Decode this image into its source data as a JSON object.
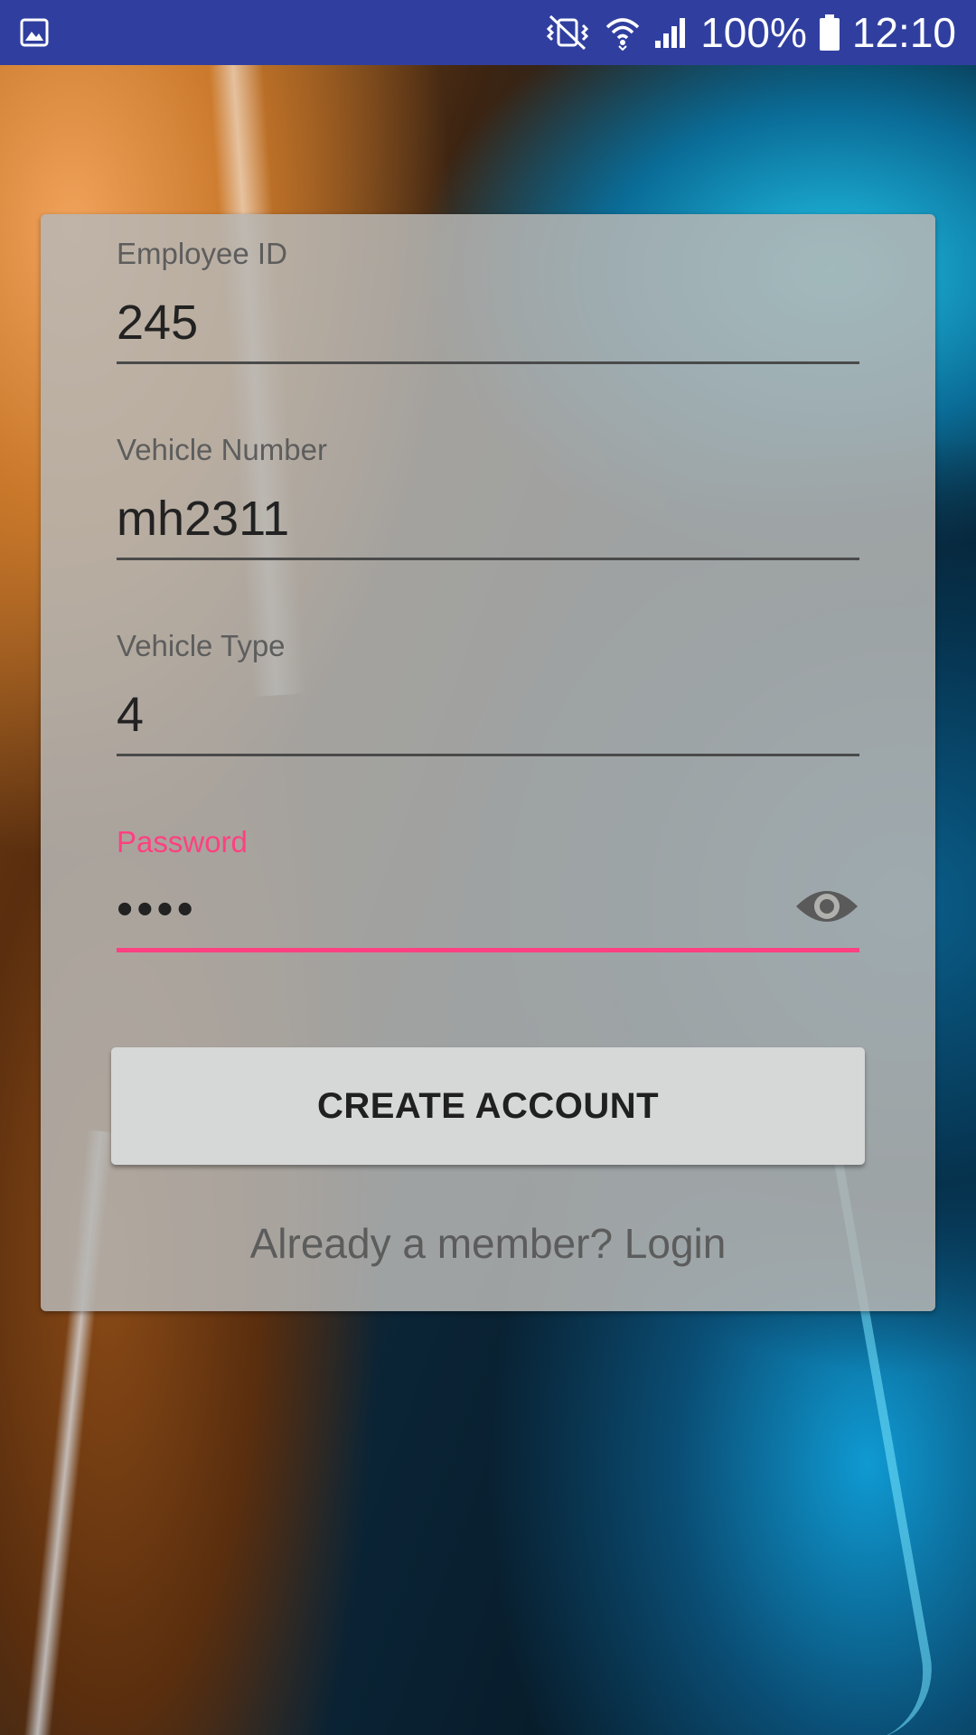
{
  "status_bar": {
    "battery": "100%",
    "time": "12:10",
    "icons": [
      "gallery-icon",
      "mute-vibrate-icon",
      "wifi-icon",
      "signal-icon",
      "battery-icon"
    ]
  },
  "form": {
    "employee_id": {
      "label": "Employee ID",
      "value": "245"
    },
    "vehicle_number": {
      "label": "Vehicle Number",
      "value": "mh2311"
    },
    "vehicle_type": {
      "label": "Vehicle Type",
      "value": "4"
    },
    "password": {
      "label": "Password",
      "value": "••••",
      "toggle_icon": "eye-icon"
    },
    "submit_label": "CREATE ACCOUNT",
    "login_prompt": "Already a member? Login"
  },
  "colors": {
    "status_bar": "#303f9f",
    "accent": "#ff4081",
    "card": "#b7b7b4",
    "button": "#d6d7d7"
  }
}
